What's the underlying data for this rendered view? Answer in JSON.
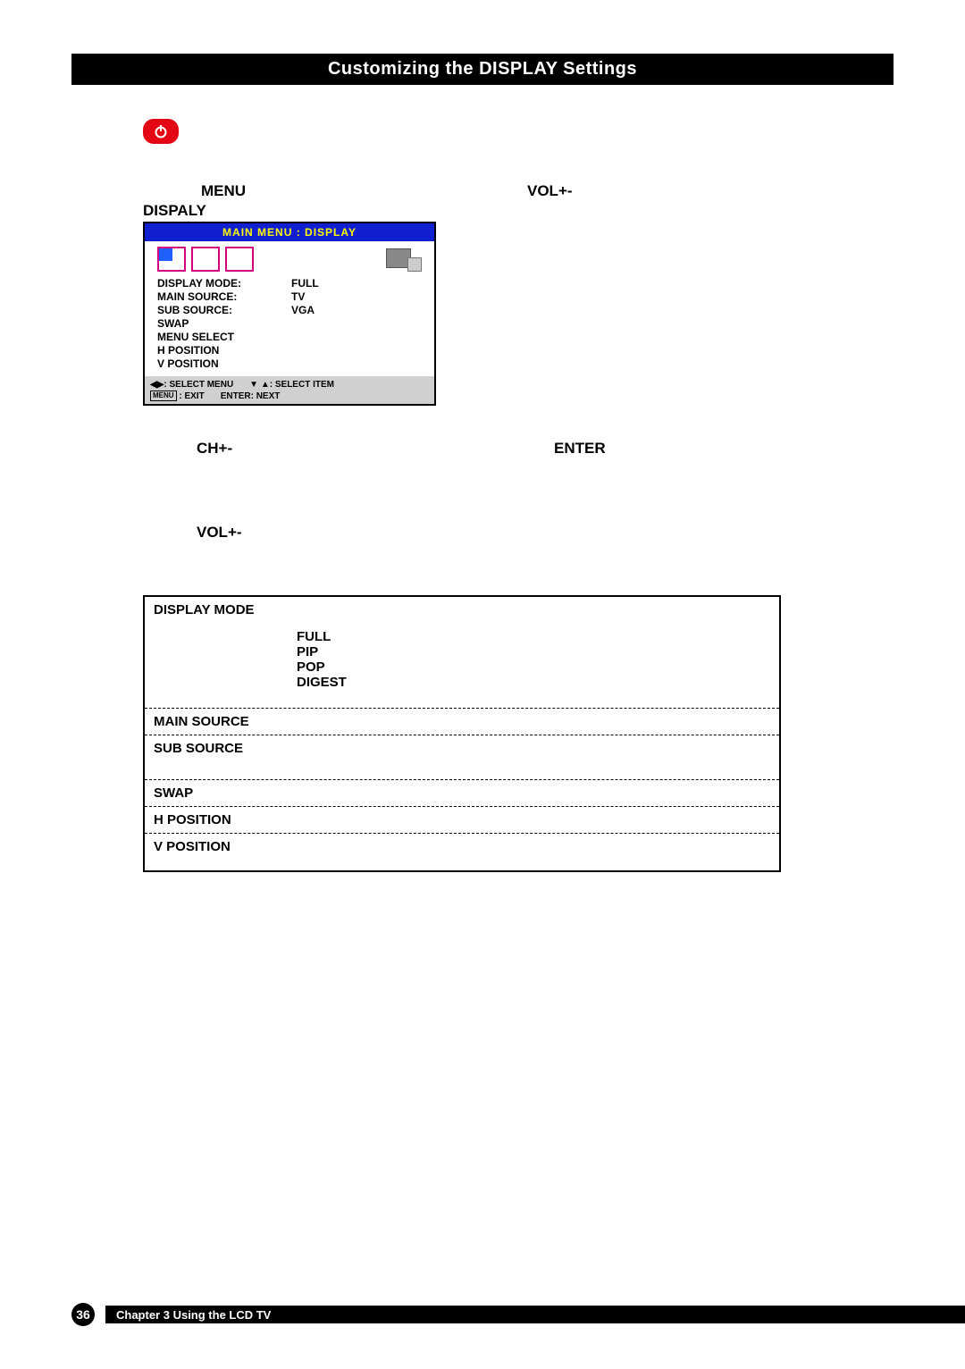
{
  "title_bar": "Customizing the DISPLAY Settings",
  "labels": {
    "menu": "MENU",
    "volplus_top": "VOL+-",
    "dispaly": "DISPALY",
    "chplus": "CH+-",
    "enter": "ENTER",
    "volplus_bottom": "VOL+-"
  },
  "osd": {
    "header": "MAIN MENU : DISPLAY",
    "items": [
      {
        "label": "DISPLAY MODE:",
        "value": "FULL"
      },
      {
        "label": "MAIN SOURCE:",
        "value": "TV"
      },
      {
        "label": "SUB SOURCE:",
        "value": "VGA"
      },
      {
        "label": "SWAP",
        "value": ""
      },
      {
        "label": "MENU SELECT",
        "value": ""
      },
      {
        "label": "H POSITION",
        "value": ""
      },
      {
        "label": "V POSITION",
        "value": ""
      }
    ],
    "footer": {
      "select_menu": ": SELECT MENU",
      "select_item": ": SELECT ITEM",
      "menu_badge": "MENU",
      "exit": " : EXIT",
      "enter_next": "ENTER: NEXT"
    }
  },
  "table": {
    "rows": [
      {
        "name": "DISPLAY MODE",
        "options": [
          "FULL",
          "PIP",
          "POP",
          "DIGEST"
        ]
      },
      {
        "name": "MAIN SOURCE",
        "options": []
      },
      {
        "name": "SUB SOURCE",
        "options": []
      },
      {
        "name": "SWAP",
        "options": []
      },
      {
        "name": "H POSITION",
        "options": []
      },
      {
        "name": "V POSITION",
        "options": []
      }
    ]
  },
  "footer": {
    "page_number": "36",
    "chapter": "Chapter 3 Using the LCD TV"
  }
}
